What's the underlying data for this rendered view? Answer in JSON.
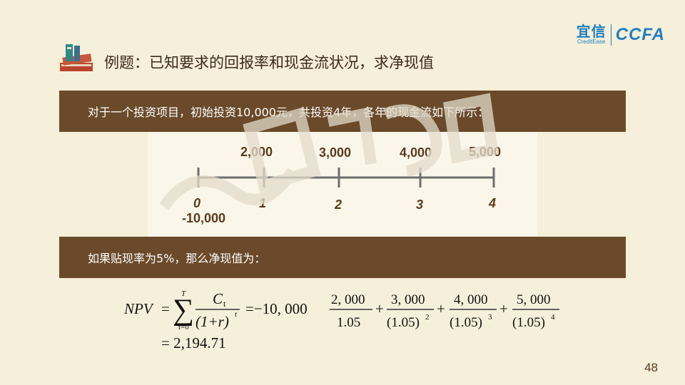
{
  "header": {
    "title": "例题：已知要求的回报率和现金流状况，求净现值",
    "logo_cn": "宜信",
    "logo_en": "CreditEase",
    "logo_ccfa": "CCFA"
  },
  "band1": {
    "text": "对于一个投资项目，初始投资10,000元，共投资4年，各年的现金流如下所示："
  },
  "timeline": {
    "cash_flows": [
      "2,000",
      "3,000",
      "4,000",
      "5,000"
    ],
    "years": [
      "0",
      "1",
      "2",
      "3",
      "4"
    ],
    "initial": "-10,000"
  },
  "band2": {
    "text": "如果贴现率为5%，那么净现值为："
  },
  "formula": {
    "npv": "NPV",
    "eq": "=",
    "sum_top": "T",
    "sum_bottom": "t=0",
    "ct": "C",
    "ct_sub": "t",
    "denom": "(1+r)",
    "denom_exp": "t",
    "initial": "=−10, 000",
    "terms": [
      {
        "num": "2, 000",
        "den": "1.05",
        "exp": ""
      },
      {
        "num": "3, 000",
        "den": "(1.05)",
        "exp": "2"
      },
      {
        "num": "4, 000",
        "den": "(1.05)",
        "exp": "3"
      },
      {
        "num": "5, 000",
        "den": "(1.05)",
        "exp": "4"
      }
    ],
    "result": "= 2,194.71"
  },
  "page_number": "48",
  "colors": {
    "band": "#6a4a2a",
    "background": "#f6efd9",
    "accent": "#1f7fc2"
  }
}
